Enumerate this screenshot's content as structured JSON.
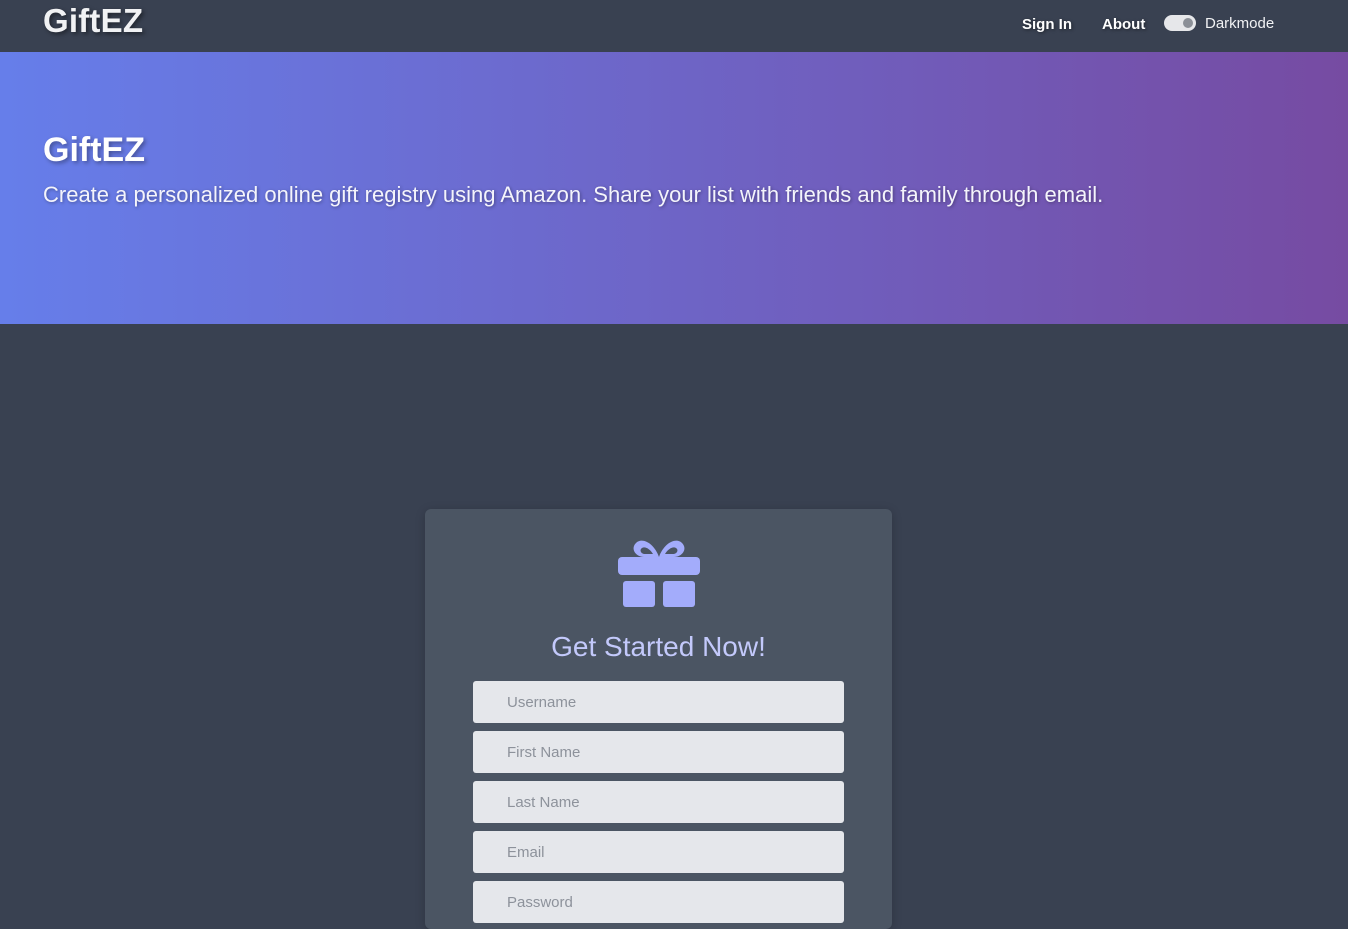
{
  "navbar": {
    "brand": "GiftEZ",
    "links": {
      "sign_in": "Sign In",
      "about": "About"
    },
    "darkmode": {
      "label": "Darkmode",
      "enabled": true
    }
  },
  "hero": {
    "title": "GiftEZ",
    "subtitle": "Create a personalized online gift registry using Amazon. Share your list with friends and family through email."
  },
  "signup_card": {
    "icon": "gift-icon",
    "title": "Get Started Now!",
    "fields": {
      "username": {
        "placeholder": "Username",
        "value": ""
      },
      "first_name": {
        "placeholder": "First Name",
        "value": ""
      },
      "last_name": {
        "placeholder": "Last Name",
        "value": ""
      },
      "email": {
        "placeholder": "Email",
        "value": ""
      },
      "password": {
        "placeholder": "Password",
        "value": ""
      }
    }
  },
  "colors": {
    "page_background": "#394151",
    "hero_gradient_start": "#667eea",
    "hero_gradient_end": "#764ba2",
    "card_background": "#4b5563",
    "accent": "#a3acfb"
  }
}
